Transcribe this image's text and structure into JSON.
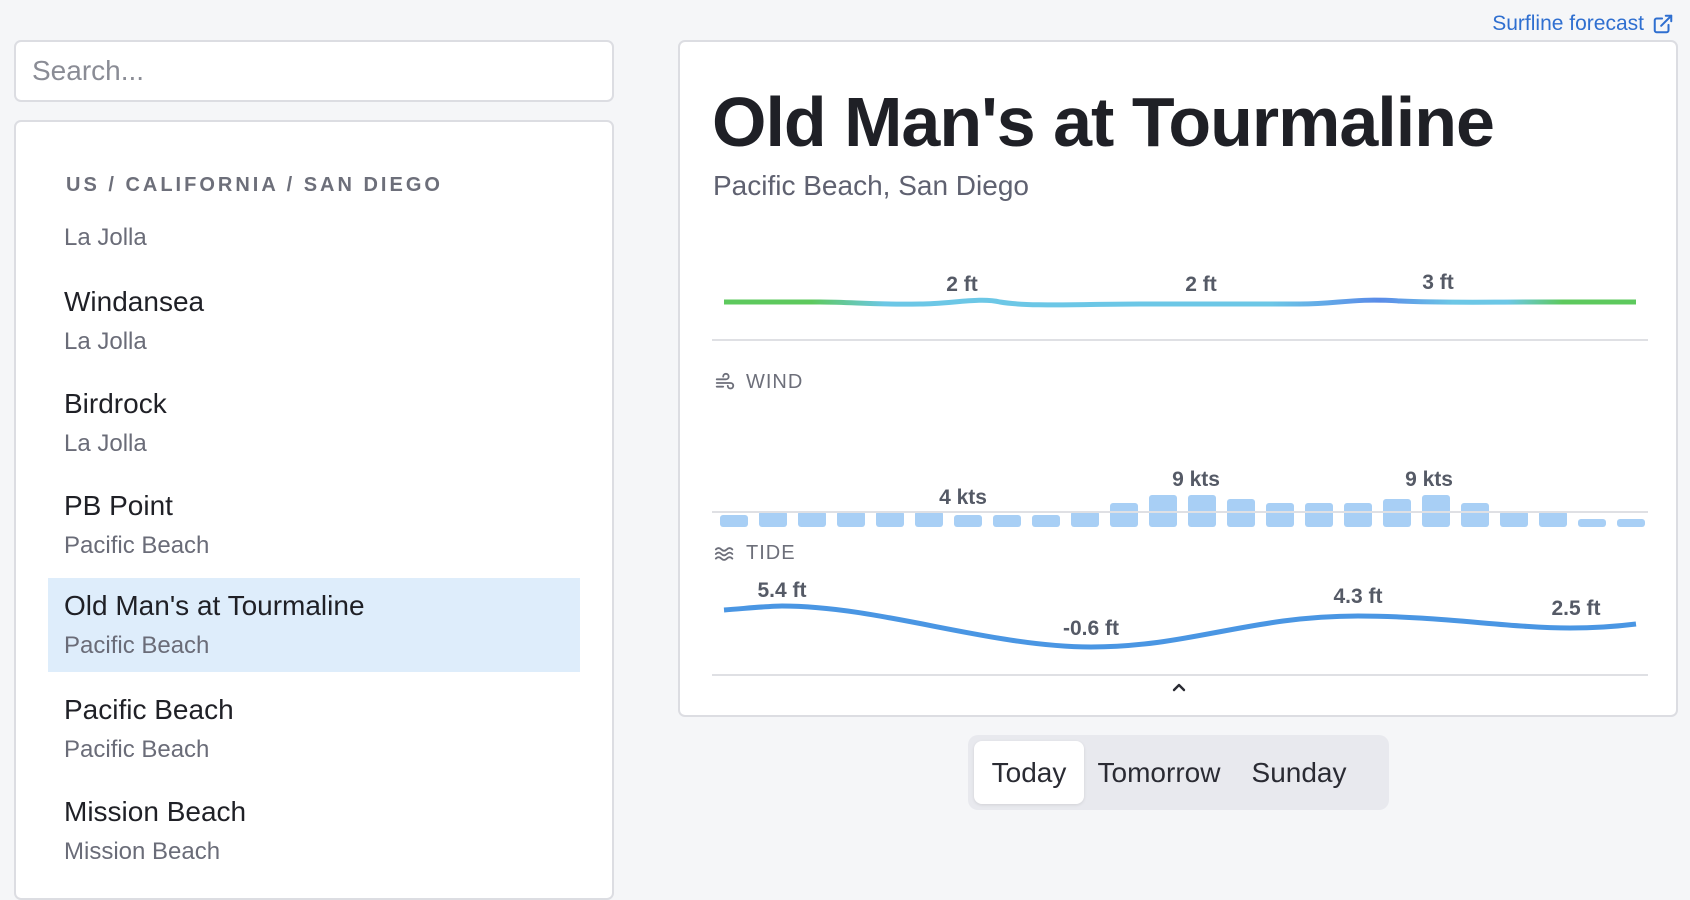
{
  "search": {
    "placeholder": "Search..."
  },
  "sidebar": {
    "region": "US / CALIFORNIA / SAN DIEGO",
    "items": [
      {
        "name": "",
        "sub": "La Jolla"
      },
      {
        "name": "Windansea",
        "sub": "La Jolla"
      },
      {
        "name": "Birdrock",
        "sub": "La Jolla"
      },
      {
        "name": "PB Point",
        "sub": "Pacific Beach"
      },
      {
        "name": "Old Man's at Tourmaline",
        "sub": "Pacific Beach",
        "selected": true
      },
      {
        "name": "Pacific Beach",
        "sub": "Pacific Beach"
      },
      {
        "name": "Mission Beach",
        "sub": "Mission Beach"
      }
    ]
  },
  "header": {
    "link_label": "Surfline forecast",
    "link_icon": "external-link-icon"
  },
  "spot": {
    "title": "Old Man's at Tourmaline",
    "subtitle": "Pacific Beach, San Diego"
  },
  "surf": {
    "labels": [
      "2 ft",
      "2 ft",
      "3 ft"
    ],
    "colors": {
      "green": "#5dc95d",
      "light_blue": "#6cc7e6",
      "mid_blue": "#5a8be8"
    }
  },
  "wind": {
    "label": "WIND",
    "icon": "wind-icon",
    "labels": [
      "4 kts",
      "9 kts",
      "9 kts"
    ],
    "speeds_kts": [
      3,
      4,
      4,
      4,
      4,
      4,
      3,
      3,
      3,
      4,
      6,
      8,
      8,
      7,
      6,
      6,
      6,
      7,
      8,
      6,
      4,
      4,
      2,
      2
    ],
    "bar_color": "#a8cff5"
  },
  "tide": {
    "label": "TIDE",
    "icon": "waves-icon",
    "labels": [
      "5.4 ft",
      "-0.6 ft",
      "4.3 ft",
      "2.5 ft"
    ],
    "line_color": "#4a96e3"
  },
  "collapse_icon": "chevron-up-icon",
  "days": [
    {
      "label": "Today",
      "active": true
    },
    {
      "label": "Tomorrow",
      "active": false
    },
    {
      "label": "Sunday",
      "active": false
    }
  ]
}
